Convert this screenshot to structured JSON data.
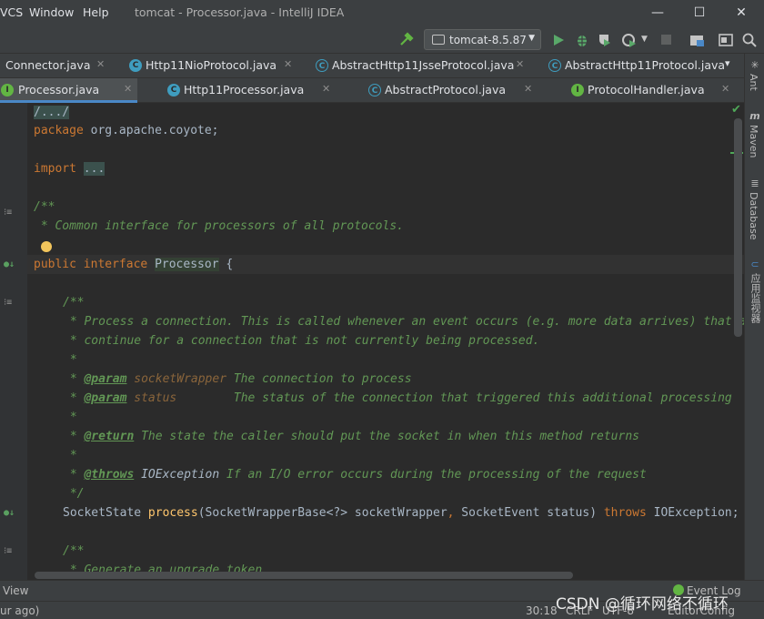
{
  "menu": {
    "vcs": "VCS",
    "window": "Window",
    "help": "Help"
  },
  "window_title": "tomcat - Processor.java - IntelliJ IDEA",
  "window_controls": {
    "minimize": "—",
    "maximize": "☐",
    "close": "✕"
  },
  "run_config": {
    "label": "tomcat-8.5.87"
  },
  "tabs_row1": [
    {
      "label": "Connector.java",
      "icon": "class-icon",
      "close": "✕"
    },
    {
      "label": "Http11NioProtocol.java",
      "icon": "class-icon",
      "close": "✕"
    },
    {
      "label": "AbstractHttp11JsseProtocol.java",
      "icon": "abstract-class-icon",
      "close": "✕"
    },
    {
      "label": "AbstractHttp11Protocol.java",
      "icon": "abstract-class-icon",
      "close": "✕"
    }
  ],
  "tabs_row2": [
    {
      "label": "Processor.java",
      "icon": "interface-icon",
      "active": true,
      "close": "✕"
    },
    {
      "label": "Http11Processor.java",
      "icon": "class-icon",
      "close": "✕"
    },
    {
      "label": "AbstractProtocol.java",
      "icon": "abstract-class-icon",
      "close": "✕"
    },
    {
      "label": "ProtocolHandler.java",
      "icon": "interface-icon",
      "close": "✕"
    }
  ],
  "tab_overflow": "▾",
  "code": {
    "l1": "/.../",
    "l2_kw": "package",
    "l2_rest": " org.apache.coyote;",
    "l3_kw": "import",
    "l3_fold": "...",
    "l4": "/**",
    "l5": " * Common interface for processors of all protocols.",
    "l6_kw1": "public",
    "l6_kw2": "interface",
    "l6_name": "Processor",
    "l6_brace": " {",
    "l7": "/**",
    "l8": " * Process a connection. This is called whenever an event occurs (e.g. more data arrives) that allows processing to",
    "l9": " * continue for a connection that is not currently being processed.",
    "l10": " *",
    "l11_pre": " * ",
    "l11_tag": "@param",
    "l11_param": " socketWrapper",
    "l11_rest": " The connection to process",
    "l12_pre": " * ",
    "l12_tag": "@param",
    "l12_param": " status",
    "l12_rest": "        The status of the connection that triggered this additional processing",
    "l13": " *",
    "l14_pre": " * ",
    "l14_tag": "@return",
    "l14_rest": " The state the caller should put the socket in when this method returns",
    "l15": " *",
    "l16_pre": " * ",
    "l16_tag": "@throws",
    "l16_type": " IOException",
    "l16_rest": " If an I/O error occurs during the processing of the request",
    "l17": " */",
    "l18_type": "SocketState ",
    "l18_method": "process",
    "l18_args": "(SocketWrapperBase<?> socketWrapper",
    "l18_comma": ",",
    "l18_args2": " SocketEvent status) ",
    "l18_throws": "throws",
    "l18_exc": " IOException;",
    "l19": "/**",
    "l20": " * Generate an upgrade token."
  },
  "right_tools": {
    "ant": "Ant",
    "maven": "Maven",
    "database": "Database",
    "plugin": "应用监视器"
  },
  "bottom": {
    "view": "View",
    "event_log": "Event Log"
  },
  "status": {
    "left": "ur ago)",
    "position": "30:18",
    "line_sep": "CRLF",
    "encoding": "UTF-8",
    "editor_config": "EditorConfig"
  },
  "watermark": "CSDN @循环网络不循环"
}
